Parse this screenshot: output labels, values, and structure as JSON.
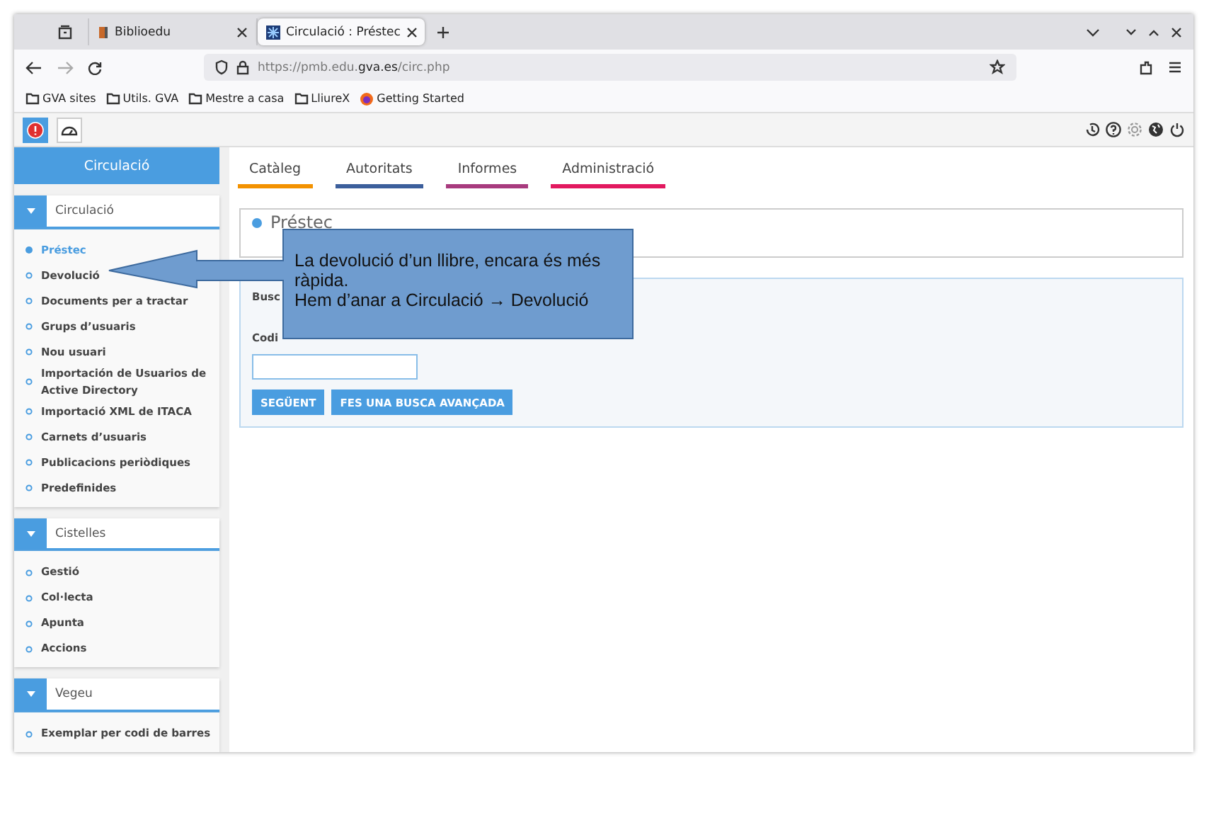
{
  "browser": {
    "tabs": [
      {
        "title": "Biblioedu",
        "selected": false
      },
      {
        "title": "Circulació : Préstec",
        "selected": true
      }
    ],
    "url": {
      "prefix": "https://pmb.edu.",
      "domain": "gva.es",
      "path": "/circ.php"
    },
    "bookmarks": [
      {
        "kind": "folder",
        "label": "GVA sites"
      },
      {
        "kind": "folder",
        "label": "Utils. GVA"
      },
      {
        "kind": "folder",
        "label": "Mestre a casa"
      },
      {
        "kind": "folder",
        "label": "LliureX"
      },
      {
        "kind": "firefox",
        "label": "Getting Started"
      }
    ]
  },
  "app": {
    "module": "Circulació",
    "tabs": [
      {
        "label": "Catàleg",
        "color": "#f39200"
      },
      {
        "label": "Autoritats",
        "color": "#3c5f9c"
      },
      {
        "label": "Informes",
        "color": "#a83b7e"
      },
      {
        "label": "Administració",
        "color": "#e2195f"
      }
    ],
    "sidebar": [
      {
        "title": "Circulació",
        "items": [
          {
            "label": "Préstec",
            "selected": true
          },
          {
            "label": "Devolució",
            "selected": false
          },
          {
            "label": "Documents per a tractar",
            "selected": false
          },
          {
            "label": "Grups d’usuaris",
            "selected": false
          },
          {
            "label": "Nou usuari",
            "selected": false
          },
          {
            "label": "Importación de Usuarios de Active Directory",
            "selected": false
          },
          {
            "label": "Importació XML de ITACA",
            "selected": false
          },
          {
            "label": "Carnets d’usuaris",
            "selected": false
          },
          {
            "label": "Publicacions periòdiques",
            "selected": false
          },
          {
            "label": "Predefinides",
            "selected": false
          }
        ]
      },
      {
        "title": "Cistelles",
        "items": [
          {
            "label": "Gestió",
            "selected": false
          },
          {
            "label": "Col·lecta",
            "selected": false
          },
          {
            "label": "Apunta",
            "selected": false
          },
          {
            "label": "Accions",
            "selected": false
          }
        ]
      },
      {
        "title": "Vegeu",
        "items": [
          {
            "label": "Exemplar per codi de barres",
            "selected": false
          }
        ]
      }
    ],
    "panel_title": "Préstec",
    "search": {
      "title": "Busc",
      "field_label": "Codi"
    },
    "buttons": [
      "SEGÜENT",
      "FES UNA BUSCA AVANÇADA"
    ]
  },
  "callout": {
    "lines": [
      "La devolució d’un llibre, encara és més ràpida.",
      "Hem d’anar a Circulació → Devolució"
    ]
  }
}
